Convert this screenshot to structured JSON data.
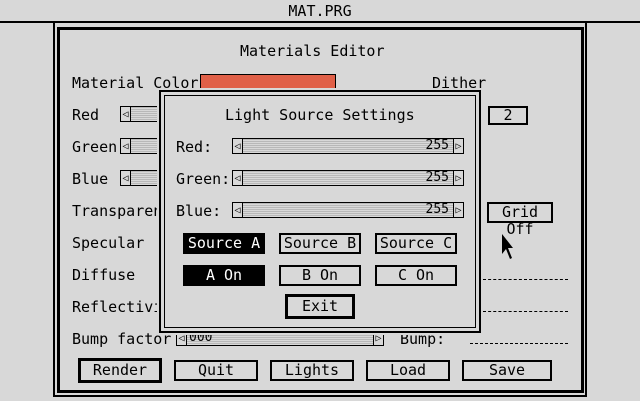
{
  "window": {
    "title": "MAT.PRG"
  },
  "editor": {
    "title": "Materials Editor",
    "material_color_label": "Material Color:",
    "material_color": "#e06048",
    "dither_label": "Dither",
    "dither_value": "2",
    "labels": {
      "red": "Red",
      "green": "Green",
      "blue": "Blue",
      "transparency": "Transparenc",
      "specular": "Specular",
      "diffuse": "Diffuse",
      "reflectivity": "Reflectivit",
      "bump_factor": "Bump factor",
      "bump": "Bump:"
    },
    "bump_factor_value": "000",
    "grid_button": "Grid Off",
    "buttons": {
      "render": "Render",
      "quit": "Quit",
      "lights": "Lights",
      "load": "Load",
      "save": "Save"
    }
  },
  "dialog": {
    "title": "Light Source Settings",
    "red_label": "Red:",
    "green_label": "Green:",
    "blue_label": "Blue:",
    "red_value": "255",
    "green_value": "255",
    "blue_value": "255",
    "sources": [
      "Source A",
      "Source B",
      "Source C"
    ],
    "toggles": [
      "A On",
      "B On",
      "C On"
    ],
    "exit_label": "Exit"
  },
  "arrows": {
    "left": "◁",
    "right": "▷"
  }
}
